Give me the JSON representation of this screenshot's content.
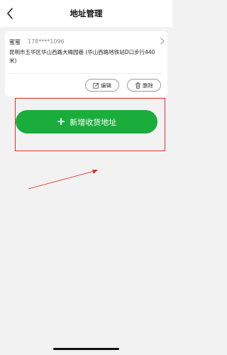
{
  "header": {
    "title": "地址管理",
    "back_icon": "chevron-left-icon"
  },
  "address_card": {
    "name": "蜜蜜",
    "phone": "178****1096",
    "address": "昆明市五华区华山西路大梅园巷 (华山西路地铁站D口步行440米)",
    "edit_label": "编辑",
    "delete_label": "删除",
    "edit_icon": "edit-icon",
    "delete_icon": "trash-icon",
    "chevron_icon": "chevron-right-icon"
  },
  "actions": {
    "add_address_label": "新增收货地址",
    "add_icon": "plus-icon"
  },
  "colors": {
    "primary_green": "#1aad3c",
    "annotation_red": "#e0312b",
    "background": "#f2f2f2"
  }
}
